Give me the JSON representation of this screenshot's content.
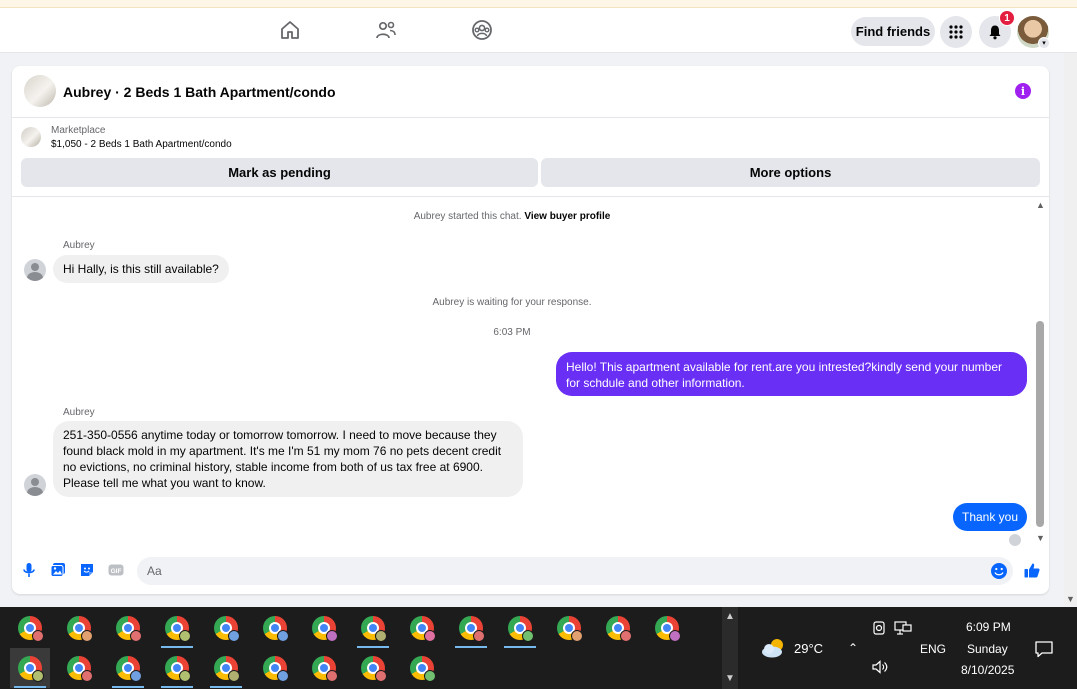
{
  "nav": {
    "find_friends": "Find friends",
    "notification_count": "1",
    "icons": [
      "home-icon",
      "friends-icon",
      "groups-icon",
      "menu-grid-icon",
      "bell-icon"
    ]
  },
  "conversation": {
    "title": "Aubrey · 2 Beds 1 Bath Apartment/condo",
    "marketplace_label": "Marketplace",
    "listing": "$1,050 - 2 Beds 1 Bath Apartment/condo",
    "mark_pending": "Mark as pending",
    "more_options": "More options"
  },
  "chat": {
    "started_text": "Aubrey started this chat.",
    "view_profile": "View buyer profile",
    "messages": [
      {
        "sender": "Aubrey",
        "text": "Hi Hally, is this still available?"
      },
      {
        "text": "Aubrey is waiting for your response."
      },
      {
        "text": "6:03 PM"
      },
      {
        "text": "Hello! This apartment available for rent.are you intrested?kindly send your number for schdule and other information."
      },
      {
        "sender": "Aubrey",
        "text": "251-350-0556 anytime today or tomorrow tomorrow.   I need to move because they found black mold in my apartment.   It's me I'm 51 my mom 76 no pets decent credit no evictions, no criminal history, stable income from both of us tax free at 6900. Please tell me what you want to know."
      },
      {
        "text": "Thank you"
      }
    ]
  },
  "composer": {
    "placeholder": "Aa"
  },
  "taskbar": {
    "weather": "29°C",
    "language": "ENG",
    "time": "6:09 PM",
    "day": "Sunday",
    "date": "8/10/2025"
  },
  "colors": {
    "messenger_purple": "#6a2ff4",
    "messenger_blue": "#0866ff",
    "badge_red": "#e41e3f",
    "info_purple": "#a020f0"
  }
}
